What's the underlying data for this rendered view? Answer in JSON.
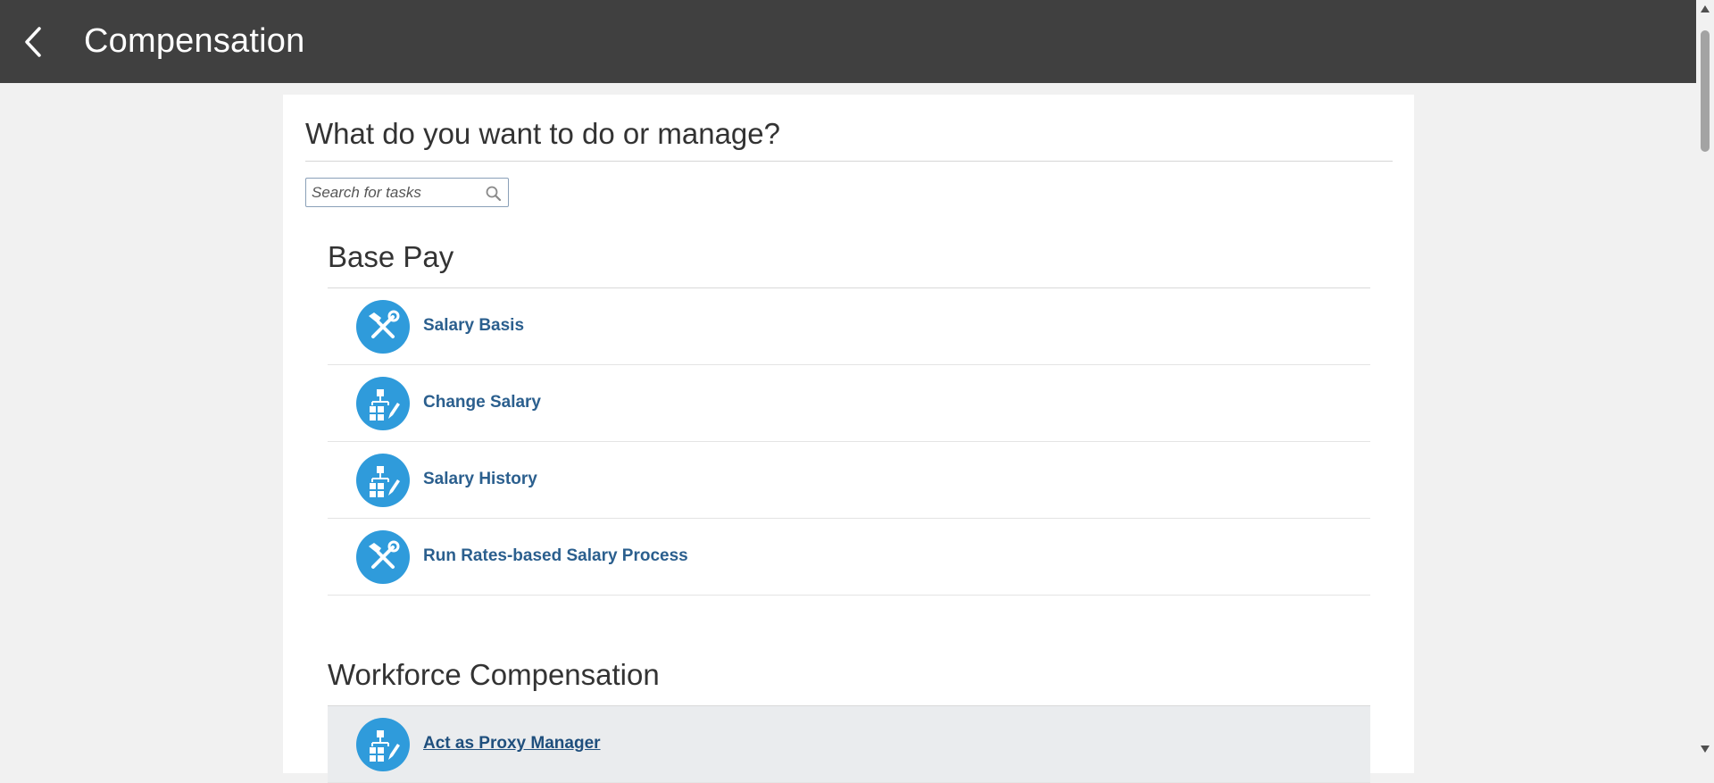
{
  "header": {
    "title": "Compensation",
    "bg_color": "#404040"
  },
  "main": {
    "question": "What do you want to do or manage?",
    "search": {
      "placeholder": "Search for tasks",
      "value": ""
    },
    "sections": [
      {
        "title": "Base Pay",
        "tasks": [
          {
            "label": "Salary Basis",
            "icon": "tools-icon"
          },
          {
            "label": "Change Salary",
            "icon": "hierarchy-edit-icon"
          },
          {
            "label": "Salary History",
            "icon": "hierarchy-edit-icon"
          },
          {
            "label": "Run Rates-based Salary Process",
            "icon": "tools-icon"
          }
        ]
      },
      {
        "title": "Workforce Compensation",
        "tasks": [
          {
            "label": "Act as Proxy Manager",
            "icon": "hierarchy-edit-icon",
            "hovered": true
          }
        ]
      }
    ]
  },
  "colors": {
    "icon_circle": "#2f9bdb",
    "link": "#2b5f8e",
    "hover_row": "#eaecee"
  }
}
